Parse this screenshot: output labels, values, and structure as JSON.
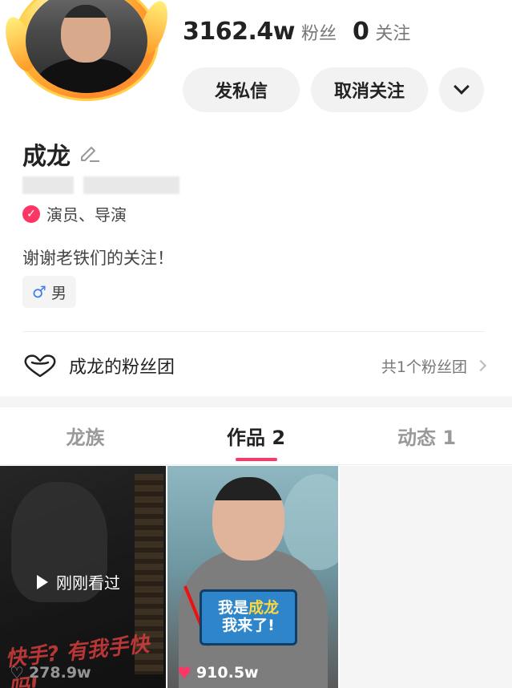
{
  "profile": {
    "name": "成龙",
    "verify_text": "演员、导演",
    "bio": "谢谢老铁们的关注！",
    "gender_symbol": "♂",
    "gender_text": "男"
  },
  "stats": {
    "fans_num": "3162.4w",
    "fans_label": "粉丝",
    "follow_num": "0",
    "follow_label": "关注"
  },
  "actions": {
    "message_label": "发私信",
    "unfollow_label": "取消关注"
  },
  "fan_group": {
    "title": "成龙的粉丝团",
    "count_text": "共1个粉丝团"
  },
  "tabs": [
    {
      "label": "龙族"
    },
    {
      "label": "作品 2"
    },
    {
      "label": "动态 1"
    }
  ],
  "works": [
    {
      "overlay_text": "刚刚看过",
      "banner_text": "快手? 有我手快吗!",
      "likes": "278.9w"
    },
    {
      "sign_line1_a": "我是",
      "sign_line1_b": "成龙",
      "sign_line2": "我来了!",
      "likes": "910.5w"
    }
  ],
  "colors": {
    "accent": "#fe3666",
    "male": "#3f7cf0"
  }
}
